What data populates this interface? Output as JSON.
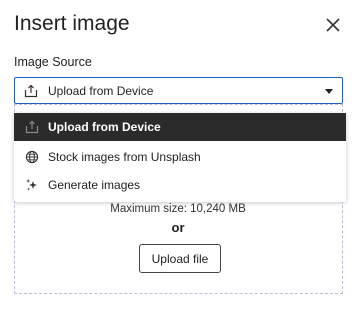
{
  "dialog": {
    "title": "Insert image",
    "close_icon": "close-icon"
  },
  "image_source": {
    "label": "Image Source",
    "selected_value": "Upload from Device",
    "selected_icon": "upload-icon",
    "options": [
      {
        "label": "Upload from Device",
        "icon": "upload-icon",
        "selected": true
      },
      {
        "label": "Stock images from Unsplash",
        "icon": "globe-icon",
        "selected": false
      },
      {
        "label": "Generate images",
        "icon": "sparkle-icon",
        "selected": false
      }
    ]
  },
  "upload": {
    "max_size": "Maximum size: 10,240 MB",
    "or": "or",
    "button_label": "Upload file"
  },
  "colors": {
    "focus_border": "#1d5fc7",
    "selected_bg": "#2b2b2b"
  }
}
